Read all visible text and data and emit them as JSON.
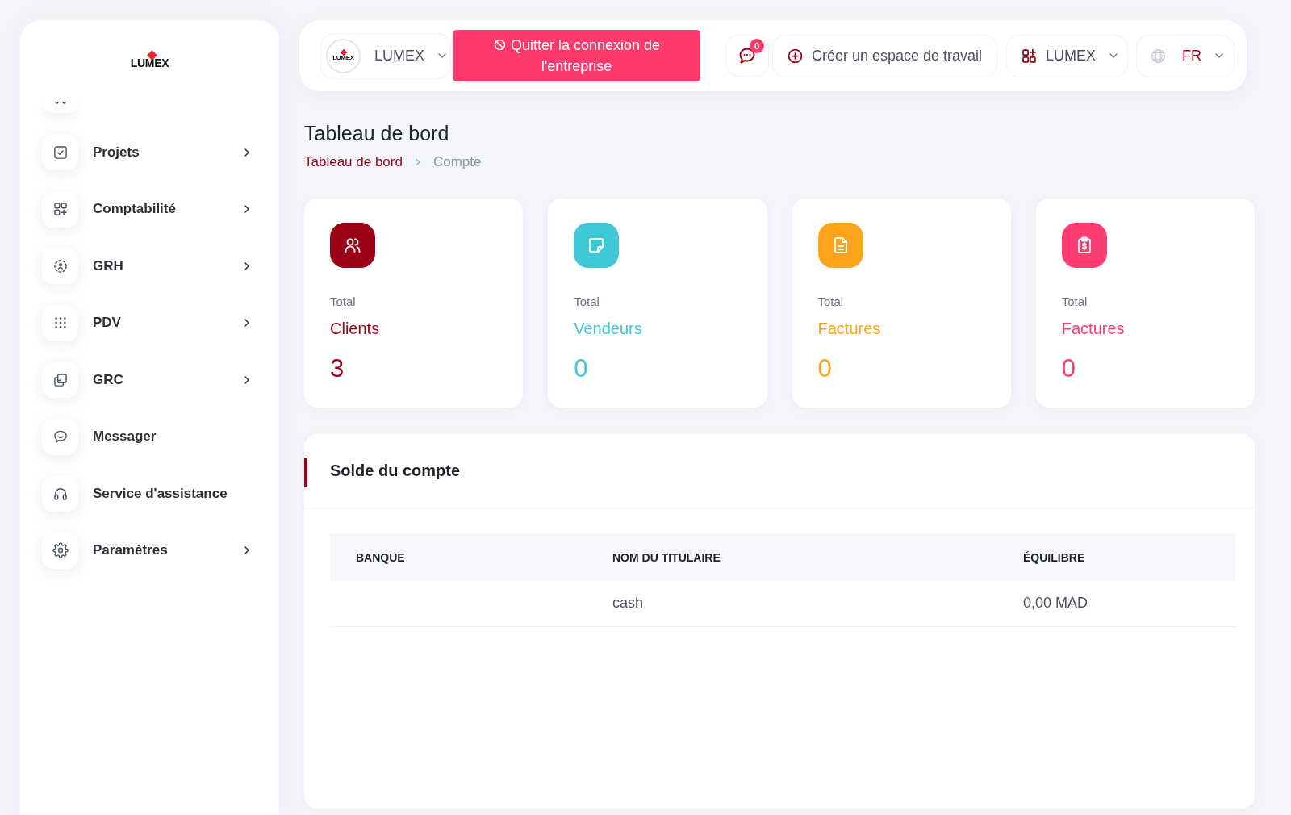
{
  "sidebar": {
    "logo_text": "LUMEX",
    "items": [
      {
        "label": "Projets",
        "has_submenu": true,
        "selected": false
      },
      {
        "label": "Comptabilité",
        "has_submenu": true,
        "selected": false
      },
      {
        "label": "GRH",
        "has_submenu": true,
        "selected": false
      },
      {
        "label": "PDV",
        "has_submenu": true,
        "selected": false
      },
      {
        "label": "GRC",
        "has_submenu": true,
        "selected": false
      },
      {
        "label": "Messager",
        "has_submenu": false,
        "selected": false
      },
      {
        "label": "Service d'assistance",
        "has_submenu": false,
        "selected": false
      },
      {
        "label": "Paramètres",
        "has_submenu": true,
        "selected": false
      }
    ]
  },
  "header": {
    "company_selector": {
      "logo_text": "LUMEX",
      "label": "LUMEX"
    },
    "exit_button": {
      "label": "Quitter la connexion de l'entreprise"
    },
    "messages": {
      "badge": "0"
    },
    "create_workspace": {
      "label": "Créer un espace de travail"
    },
    "workspace_selector": {
      "label": "LUMEX"
    },
    "language_selector": {
      "label": "FR"
    }
  },
  "page": {
    "title": "Tableau de bord",
    "breadcrumb": [
      {
        "label": "Tableau de bord",
        "current": false
      },
      {
        "label": "Compte",
        "current": true
      }
    ]
  },
  "stat_cards": [
    {
      "caption": "Total",
      "label": "Clients",
      "value": "3",
      "color": "#9b0016"
    },
    {
      "caption": "Total",
      "label": "Vendeurs",
      "value": "0",
      "color": "#3ec8d5"
    },
    {
      "caption": "Total",
      "label": "Factures",
      "value": "0",
      "color": "#ffa31a"
    },
    {
      "caption": "Total",
      "label": "Factures",
      "value": "0",
      "color": "#ff3b6f"
    }
  ],
  "account_balance": {
    "title": "Solde du compte",
    "table": {
      "columns": [
        "BANQUE",
        "NOM DU TITULAIRE",
        "ÉQUILIBRE"
      ],
      "rows": [
        {
          "holder": "cash",
          "balance": "0,00 MAD"
        }
      ]
    }
  }
}
